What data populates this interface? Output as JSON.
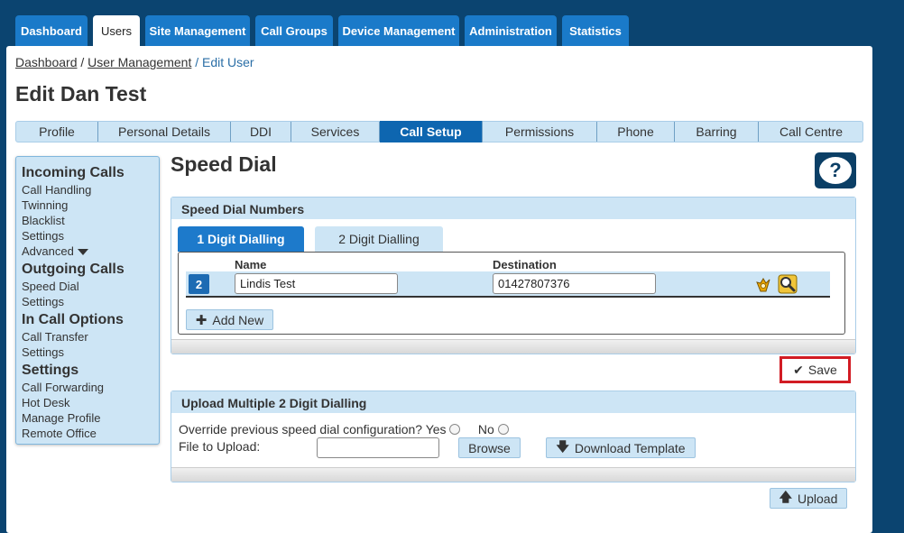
{
  "top_tabs": [
    {
      "label": "Dashboard"
    },
    {
      "label": "Users"
    },
    {
      "label": "Site Management"
    },
    {
      "label": "Call Groups"
    },
    {
      "label": "Device Management"
    },
    {
      "label": "Administration"
    },
    {
      "label": "Statistics"
    }
  ],
  "breadcrumb": {
    "item1": "Dashboard",
    "item2": "User Management",
    "current": "Edit User",
    "sep": "/"
  },
  "page_title": "Edit Dan Test",
  "sub_tabs": [
    {
      "label": "Profile"
    },
    {
      "label": "Personal Details"
    },
    {
      "label": "DDI"
    },
    {
      "label": "Services"
    },
    {
      "label": "Call Setup"
    },
    {
      "label": "Permissions"
    },
    {
      "label": "Phone"
    },
    {
      "label": "Barring"
    },
    {
      "label": "Call Centre"
    }
  ],
  "sidebar": {
    "incoming": {
      "heading": "Incoming Calls",
      "items": [
        "Call Handling",
        "Twinning",
        "Blacklist",
        "Settings",
        "Advanced"
      ]
    },
    "outgoing": {
      "heading": "Outgoing Calls",
      "items": [
        "Speed Dial",
        "Settings"
      ]
    },
    "incall": {
      "heading": "In Call Options",
      "items": [
        "Call Transfer",
        "Settings"
      ]
    },
    "settings": {
      "heading": "Settings",
      "items": [
        "Call Forwarding",
        "Hot Desk",
        "Manage Profile",
        "Remote Office"
      ]
    }
  },
  "section_title": "Speed Dial",
  "help_label": "?",
  "speed_dial": {
    "heading": "Speed Dial Numbers",
    "tabs": [
      {
        "label": "1 Digit Dialling"
      },
      {
        "label": "2 Digit Dialling"
      }
    ],
    "col_name": "Name",
    "col_destination": "Destination",
    "rows": [
      {
        "number": "2",
        "name": "Lindis Test",
        "destination": "01427807376"
      }
    ],
    "add_new_label": "Add New"
  },
  "save_label": "Save",
  "upload": {
    "heading": "Upload Multiple 2 Digit Dialling",
    "override_label": "Override previous speed dial configuration?",
    "yes_label": "Yes",
    "no_label": "No",
    "file_label": "File to Upload:",
    "file_value": "",
    "browse_label": "Browse",
    "download_label": "Download Template",
    "upload_label": "Upload"
  },
  "colors": {
    "nav": "#0b4470",
    "accent": "#1a7ac9",
    "light": "#cde5f5",
    "highlight": "#d21c24"
  }
}
